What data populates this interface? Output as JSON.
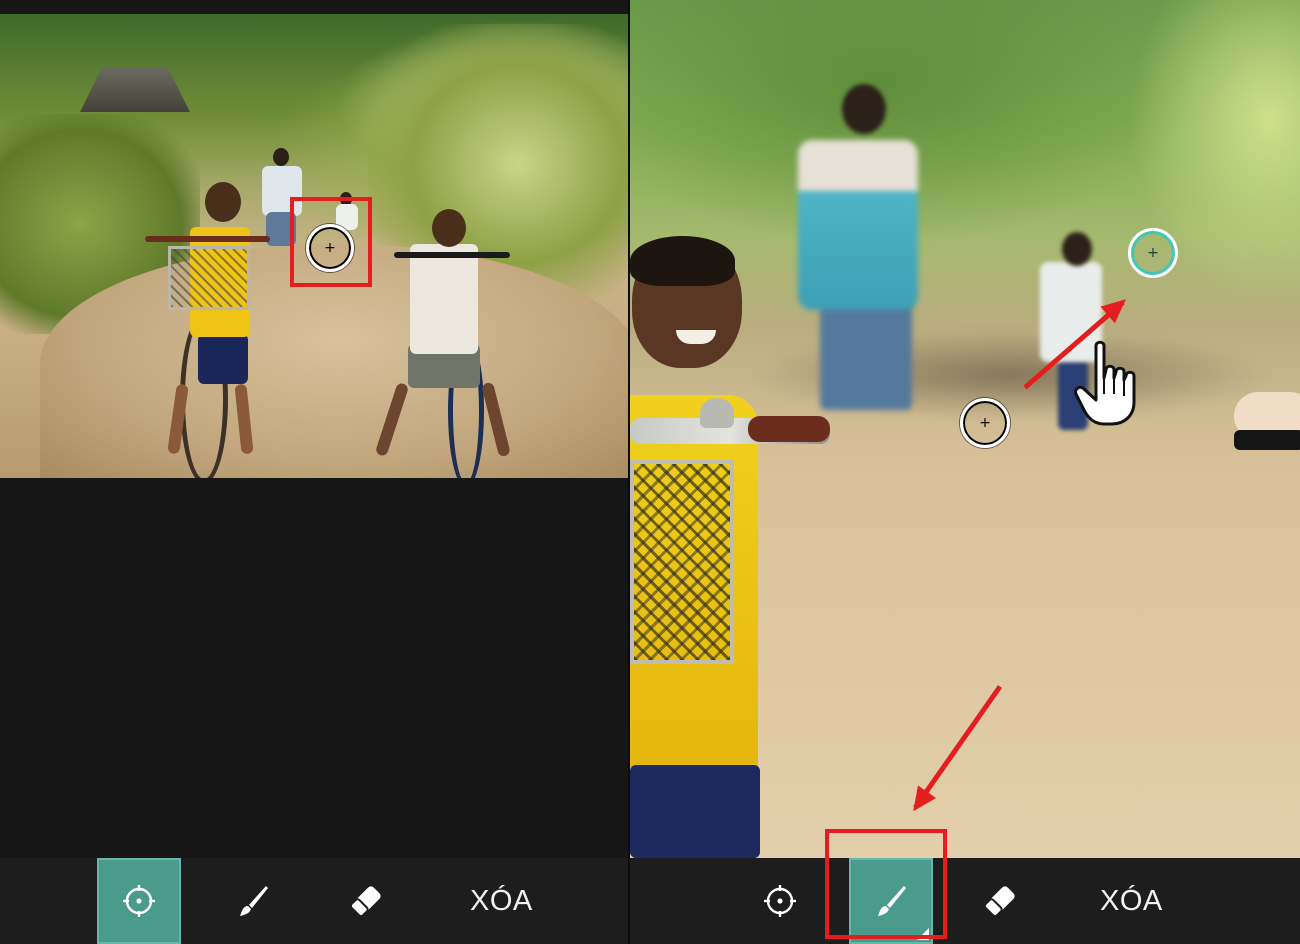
{
  "toolbar_left": {
    "tools": [
      {
        "name": "target",
        "icon": "crosshair-icon",
        "active": true
      },
      {
        "name": "brush",
        "icon": "brush-icon",
        "active": false
      },
      {
        "name": "eraser",
        "icon": "eraser-icon",
        "active": false
      }
    ],
    "delete_label": "XÓA"
  },
  "toolbar_right": {
    "tools": [
      {
        "name": "target",
        "icon": "crosshair-icon",
        "active": false
      },
      {
        "name": "brush",
        "icon": "brush-icon",
        "active": true
      },
      {
        "name": "eraser",
        "icon": "eraser-icon",
        "active": false
      }
    ],
    "delete_label": "XÓA"
  },
  "colors": {
    "accent_teal": "#4b9b8d",
    "highlight_red": "#e41e1e",
    "toolbar_bg": "#1d1d1d"
  },
  "overlay_icons": [
    "crosshair-circle",
    "teal-crosshair-circle",
    "pointing-hand-icon",
    "red-arrow"
  ]
}
